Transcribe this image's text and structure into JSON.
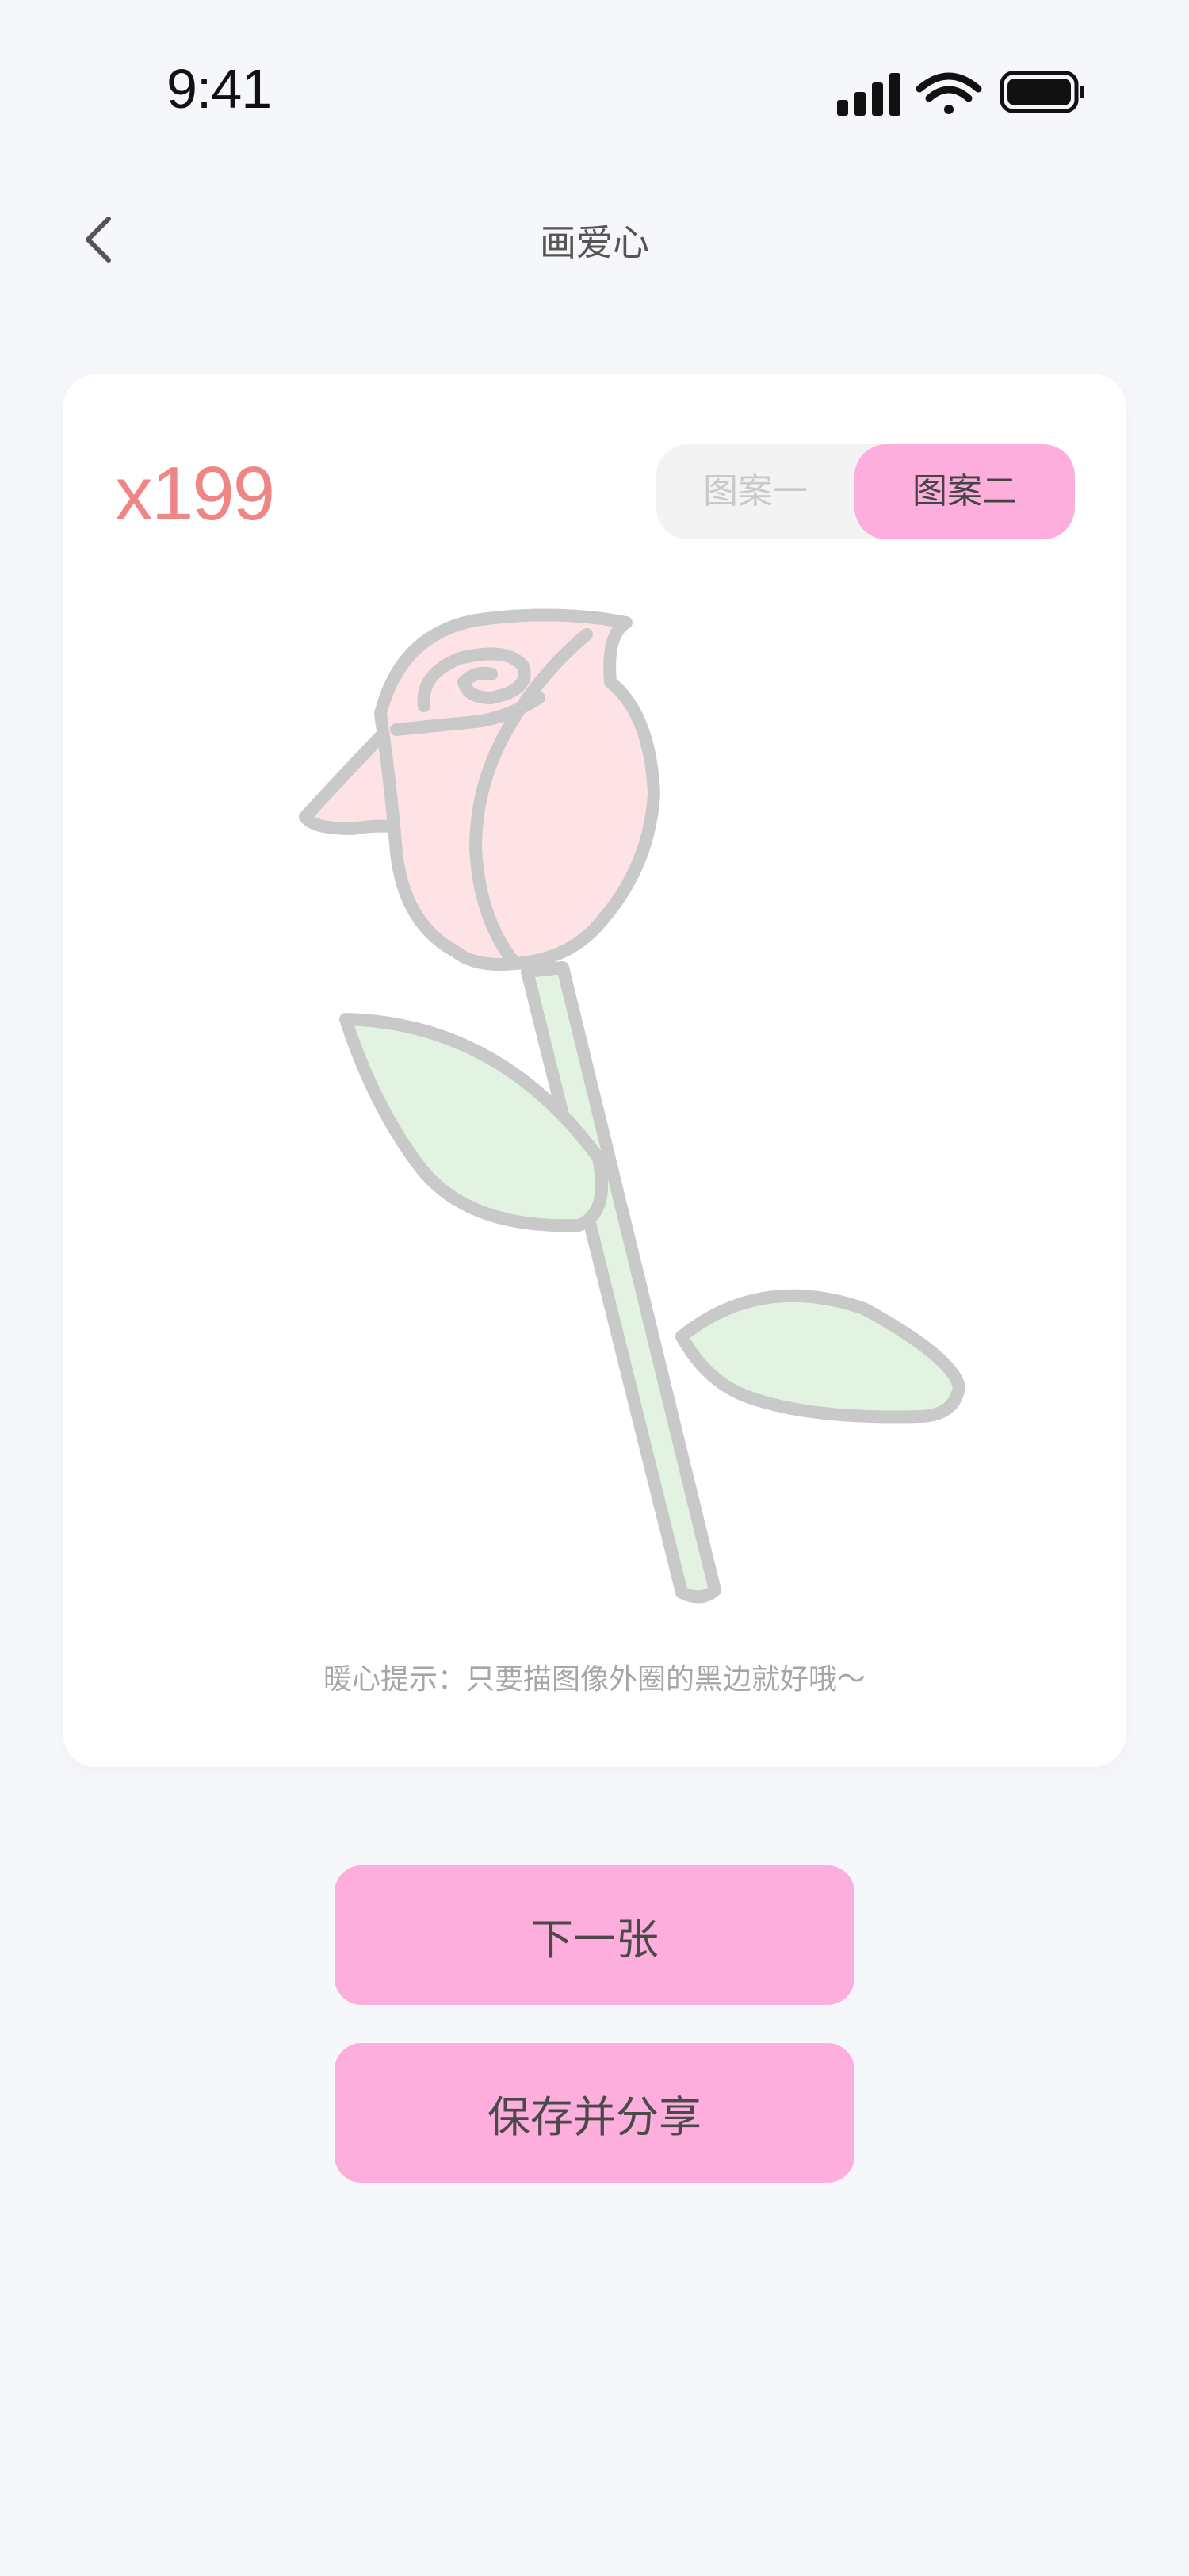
{
  "status_bar": {
    "time": "9:41",
    "icons": [
      "signal-icon",
      "wifi-icon",
      "battery-icon"
    ]
  },
  "nav": {
    "title": "画爱心",
    "back_icon": "chevron-left-icon"
  },
  "card": {
    "count": "x199",
    "segments": [
      {
        "label": "图案一",
        "selected": false
      },
      {
        "label": "图案二",
        "selected": true
      }
    ],
    "illustration": "rose-outline",
    "tip": "暖心提示：只要描图像外圈的黑边就好哦～"
  },
  "actions": {
    "next_label": "下一张",
    "save_share_label": "保存并分享"
  },
  "colors": {
    "background": "#f5f7fb",
    "accent_pink": "#fdaedc",
    "count_red": "#ef8585",
    "petal_pink": "#fde3e5",
    "leaf_green": "#e3f3e1",
    "outline_gray": "#c9c9c9"
  }
}
